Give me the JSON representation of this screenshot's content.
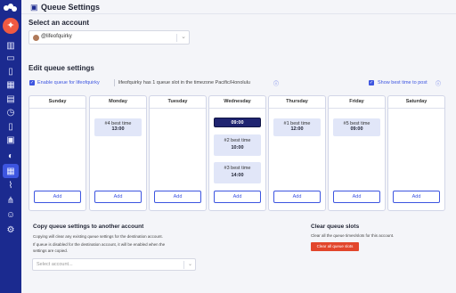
{
  "page": {
    "title": "Queue Settings"
  },
  "select_account": {
    "heading": "Select an account",
    "value": "@lifeofquirky"
  },
  "edit": {
    "heading": "Edit queue settings",
    "enable_label": "Enable queue for lifeofquirky",
    "info_text": "lifeofquirky has 1 queue slot in the timezone Pacific/Honolulu",
    "show_best_time": "Show best time to post"
  },
  "days": [
    {
      "name": "Sunday",
      "slots": [],
      "add": "Add"
    },
    {
      "name": "Monday",
      "slots": [
        {
          "label": "#4 best time",
          "time": "13:00"
        }
      ],
      "add": "Add"
    },
    {
      "name": "Tuesday",
      "slots": [],
      "add": "Add"
    },
    {
      "name": "Wednesday",
      "slots": [
        {
          "label": "",
          "time": "09:00"
        },
        {
          "label": "#2 best time",
          "time": "10:00"
        },
        {
          "label": "#3 best time",
          "time": "14:00"
        }
      ],
      "add": "Add"
    },
    {
      "name": "Thursday",
      "slots": [
        {
          "label": "#1 best time",
          "time": "12:00"
        }
      ],
      "add": "Add"
    },
    {
      "name": "Friday",
      "slots": [
        {
          "label": "#5 best time",
          "time": "09:00"
        }
      ],
      "add": "Add"
    },
    {
      "name": "Saturday",
      "slots": [],
      "add": "Add"
    }
  ],
  "copy": {
    "heading": "Copy queue settings to another account",
    "desc1": "Copying will clear any existing queue settings for the destination account.",
    "desc2": "If queue is disabled for the destination account, it will be enabled when the",
    "desc3": "settings are copied.",
    "placeholder": "Select account..."
  },
  "clear": {
    "heading": "Clear queue slots",
    "desc": "Clear all the queue times/slots for this account.",
    "button": "Clear all queue slots"
  },
  "colors": {
    "sidebar": "#1b2a8f",
    "accent": "#3d55e0",
    "danger": "#e2462b",
    "slot": "#e1e6f8",
    "slot_selected": "#1f2470"
  }
}
